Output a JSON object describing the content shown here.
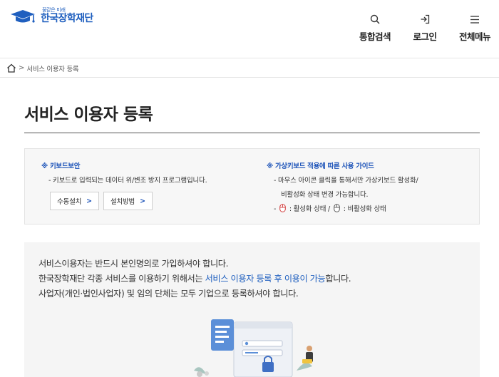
{
  "header": {
    "logo_small": "꿈같은 미래",
    "logo_main": "한국장학재단",
    "nav": [
      {
        "label": "통합검색",
        "icon": "search-icon"
      },
      {
        "label": "로그인",
        "icon": "login-icon"
      },
      {
        "label": "전체메뉴",
        "icon": "menu-icon"
      }
    ]
  },
  "breadcrumb": {
    "icon": "home-icon",
    "separator": ">",
    "current": "서비스 이용자 등록"
  },
  "page": {
    "title": "서비스 이용자 등록"
  },
  "keyboard_security": {
    "heading": "※ 키보드보안",
    "desc": "- 키보드로 입력되는 데이터 위/변조 방지 프로그램입니다.",
    "buttons": [
      {
        "label": "수동설치",
        "arrow": ">"
      },
      {
        "label": "설치방법",
        "arrow": ">"
      }
    ]
  },
  "virtual_keyboard": {
    "heading": "※ 가상키보드 적용에 따른 사용 가이드",
    "line1": "- 마우스 아이콘 클릭을 통해서만 가상키보드 활성화/",
    "line2": "비활성화 상태 변경 가능합니다.",
    "active_label": ": 활성화 상태 /",
    "inactive_label": ": 비활성화 상태",
    "dash": "-"
  },
  "notice": {
    "line1": "서비스이용자는 반드시 본인명의로 가입하셔야 합니다.",
    "line2_prefix": "한국장학재단 각종 서비스를 이용하기 위해서는 ",
    "line2_highlight": "서비스 이용자 등록 후 이용이 가능",
    "line2_suffix": "합니다.",
    "line3": "사업자(개인·법인사업자) 및 임의 단체는 모두 기업으로 등록하셔야 합니다."
  },
  "colors": {
    "brand": "#1f5fbf",
    "heading_blue": "#1b52b8",
    "active_mouse": "#d23c3c"
  }
}
